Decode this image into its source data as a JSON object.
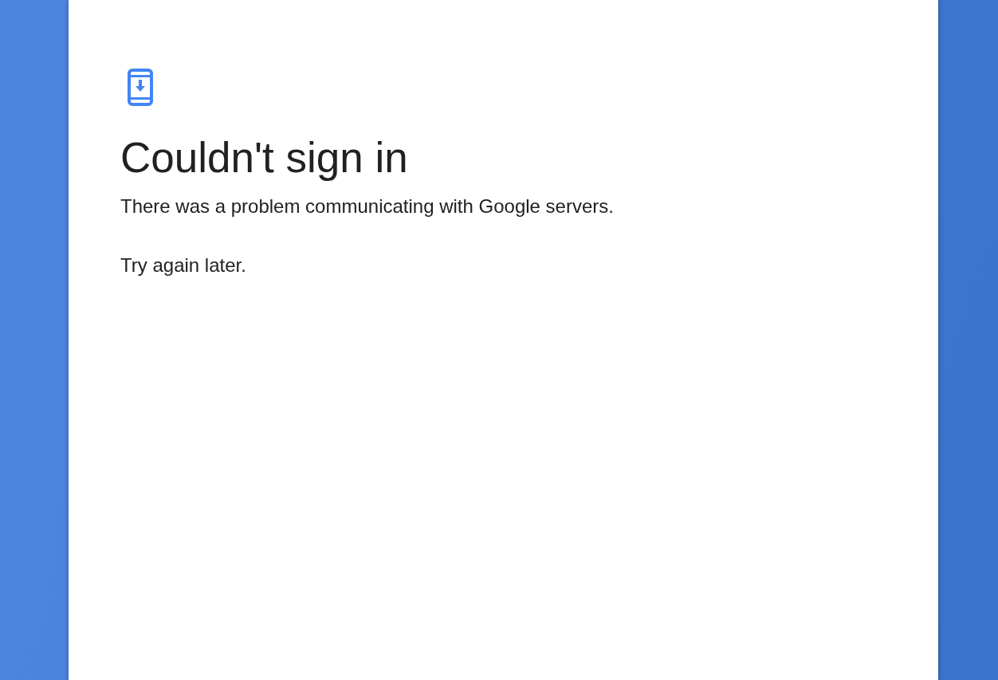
{
  "card": {
    "title": "Couldn't sign in",
    "paragraphs": [
      "There was a problem communicating with Google servers.",
      "Try again later."
    ]
  }
}
